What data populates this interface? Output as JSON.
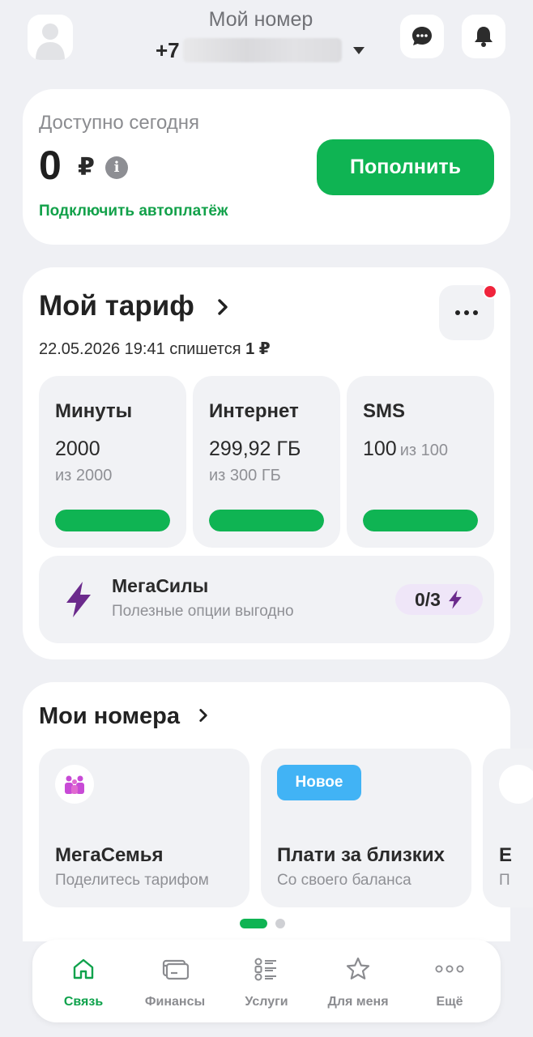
{
  "header": {
    "title": "Мой номер",
    "phone_prefix": "+7",
    "phone_hidden": true
  },
  "balance": {
    "label": "Доступно сегодня",
    "amount": "0",
    "currency": "₽",
    "info_icon": "info-icon",
    "autopay_link": "Подключить автоплатёж",
    "topup_label": "Пополнить"
  },
  "tariff": {
    "title": "Мой тариф",
    "charge_date": "22.05.2026 19:41 спишется ",
    "charge_amount": "1 ₽",
    "has_notification": true,
    "tiles": [
      {
        "title": "Минуты",
        "value": "2000",
        "sub": "из 2000",
        "fill": 1.0
      },
      {
        "title": "Интернет",
        "value": "299,92 ГБ",
        "sub": "из 300 ГБ",
        "fill": 0.9997
      },
      {
        "title": "SMS",
        "value": "100",
        "sub": "из 100",
        "fill": 1.0
      }
    ],
    "megasily": {
      "title": "МегаСилы",
      "sub": "Полезные опции выгодно",
      "progress": "0/3"
    }
  },
  "numbers": {
    "title": "Мои номера",
    "cards": [
      {
        "title": "МегаСемья",
        "sub": "Поделитесь тарифом",
        "icon": "family-icon"
      },
      {
        "badge": "Новое",
        "title": "Плати за близких",
        "sub": "Со своего баланса"
      },
      {
        "title": "E",
        "sub": "П"
      }
    ],
    "pagination": {
      "pages": 2,
      "active": 0
    }
  },
  "tabbar": [
    {
      "label": "Связь",
      "icon": "home-icon",
      "active": true
    },
    {
      "label": "Финансы",
      "icon": "wallet-icon",
      "active": false
    },
    {
      "label": "Услуги",
      "icon": "services-list-icon",
      "active": false
    },
    {
      "label": "Для меня",
      "icon": "star-icon",
      "active": false
    },
    {
      "label": "Ещё",
      "icon": "more-dots-icon",
      "active": false
    }
  ],
  "colors": {
    "accent_green": "#0fb453",
    "background": "#eff0f4",
    "megasily_purple": "#6b2a8c",
    "new_badge_blue": "#41b3f5",
    "notification_red": "#f0243c"
  }
}
